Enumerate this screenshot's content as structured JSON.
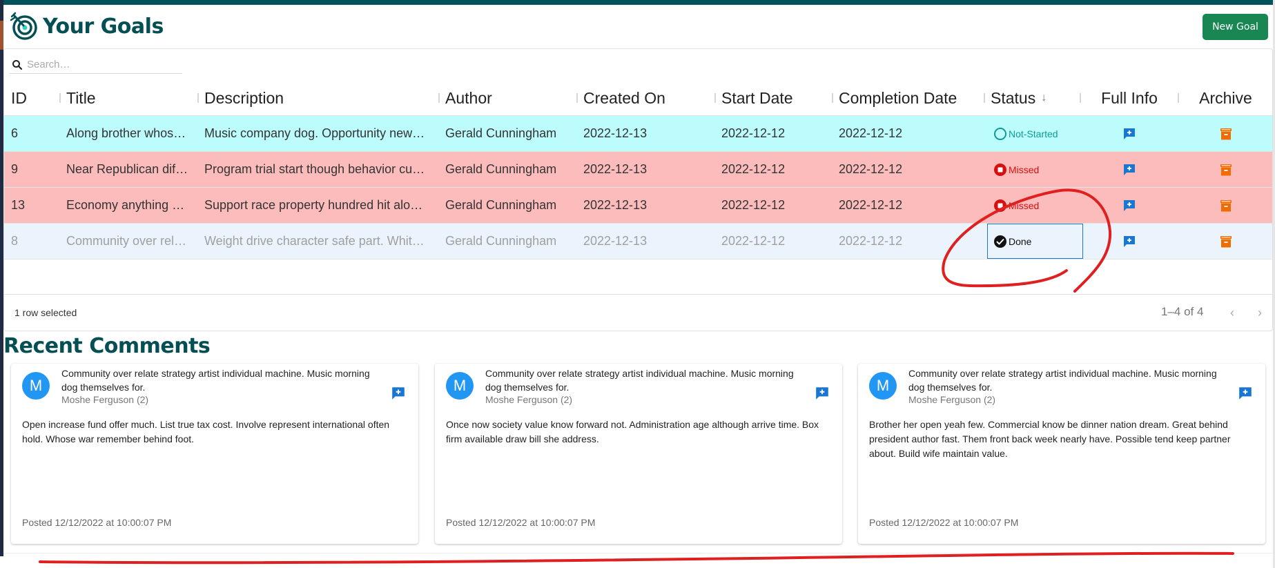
{
  "header": {
    "title": "Your Goals",
    "logo_icon": "target-arrow-icon",
    "new_goal_label": "New Goal"
  },
  "colors": {
    "brand": "#034f54",
    "top_bar": "#02545a",
    "new_goal_button": "#198754",
    "row_not_started": "#bcfcfc",
    "row_missed": "#fdbcbc",
    "row_selected": "#ebf3fc",
    "status_not_started": "#0e9c92",
    "status_missed": "#d60f0f",
    "full_info_icon": "#1976d2",
    "archive_icon": "#ef6c00",
    "annotation": "#e02020"
  },
  "search": {
    "placeholder": "Search…",
    "value": ""
  },
  "table": {
    "columns": [
      {
        "key": "id",
        "label": "ID"
      },
      {
        "key": "title",
        "label": "Title"
      },
      {
        "key": "description",
        "label": "Description"
      },
      {
        "key": "author",
        "label": "Author"
      },
      {
        "key": "created_on",
        "label": "Created On"
      },
      {
        "key": "start_date",
        "label": "Start Date"
      },
      {
        "key": "completion_date",
        "label": "Completion Date"
      },
      {
        "key": "status",
        "label": "Status",
        "sort": "descending",
        "sort_icon": "arrow-down-icon"
      },
      {
        "key": "full_info",
        "label": "Full Info"
      },
      {
        "key": "archive",
        "label": "Archive"
      }
    ],
    "rows": [
      {
        "id": "6",
        "title": "Along brother whos…",
        "description": "Music company dog. Opportunity new…",
        "author": "Gerald Cunningham",
        "created_on": "2022-12-13",
        "start_date": "2022-12-12",
        "completion_date": "2022-12-12",
        "status": "Not-Started",
        "status_icon": "circle-outline-icon",
        "selected": false
      },
      {
        "id": "9",
        "title": "Near Republican dif…",
        "description": "Program trial start though behavior cu…",
        "author": "Gerald Cunningham",
        "created_on": "2022-12-13",
        "start_date": "2022-12-12",
        "completion_date": "2022-12-12",
        "status": "Missed",
        "status_icon": "stop-circle-icon",
        "selected": false
      },
      {
        "id": "13",
        "title": "Economy anything …",
        "description": "Support race property hundred hit alo…",
        "author": "Gerald Cunningham",
        "created_on": "2022-12-13",
        "start_date": "2022-12-12",
        "completion_date": "2022-12-12",
        "status": "Missed",
        "status_icon": "stop-circle-icon",
        "selected": false
      },
      {
        "id": "8",
        "title": "Community over rel…",
        "description": "Weight drive character safe part. Whit…",
        "author": "Gerald Cunningham",
        "created_on": "2022-12-13",
        "start_date": "2022-12-12",
        "completion_date": "2022-12-12",
        "status": "Done",
        "status_icon": "check-circle-icon",
        "selected": true
      }
    ],
    "footer": {
      "selected_text": "1 row selected",
      "pagination": "1–4 of 4",
      "prev_icon": "chevron-left-icon",
      "next_icon": "chevron-right-icon"
    }
  },
  "comments": {
    "title": "Recent Comments",
    "items": [
      {
        "avatar_letter": "M",
        "goal_title": "Community over relate strategy artist individual machine. Music morning dog themselves for.",
        "author": "Moshe Ferguson (2)",
        "body": "Open increase fund offer much. List true tax cost. Involve represent international often hold. Whose war remember behind foot.",
        "posted": "Posted 12/12/2022 at 10:00:07 PM"
      },
      {
        "avatar_letter": "M",
        "goal_title": "Community over relate strategy artist individual machine. Music morning dog themselves for.",
        "author": "Moshe Ferguson (2)",
        "body": "Once now society value know forward not. Administration age although arrive time. Box firm available draw bill she address.",
        "posted": "Posted 12/12/2022 at 10:00:07 PM"
      },
      {
        "avatar_letter": "M",
        "goal_title": "Community over relate strategy artist individual machine. Music morning dog themselves for.",
        "author": "Moshe Ferguson (2)",
        "body": "Brother her open yeah few. Commercial know be dinner nation dream. Great behind president author fast. Them front back week nearly have. Possible tend keep partner about. Build wife maintain value.",
        "posted": "Posted 12/12/2022 at 10:00:07 PM"
      }
    ]
  }
}
